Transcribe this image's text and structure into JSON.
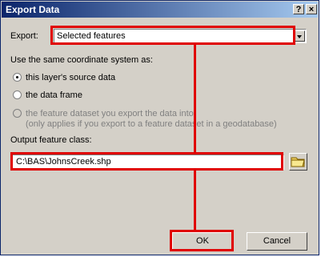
{
  "window": {
    "title": "Export Data"
  },
  "titlebar": {
    "help": "?",
    "close": "×"
  },
  "export": {
    "label": "Export:",
    "selected": "Selected features"
  },
  "coord": {
    "heading": "Use the same coordinate system as:",
    "opt1": "this layer's source data",
    "opt2": "the data frame",
    "opt3_line1": "the feature dataset you export the data into",
    "opt3_line2": "(only applies if you export to a feature dataset in a geodatabase)"
  },
  "output": {
    "label": "Output feature class:",
    "value": "C:\\BAS\\JohnsCreek.shp"
  },
  "buttons": {
    "ok": "OK",
    "cancel": "Cancel"
  },
  "annotation": {
    "color": "#e00000"
  }
}
